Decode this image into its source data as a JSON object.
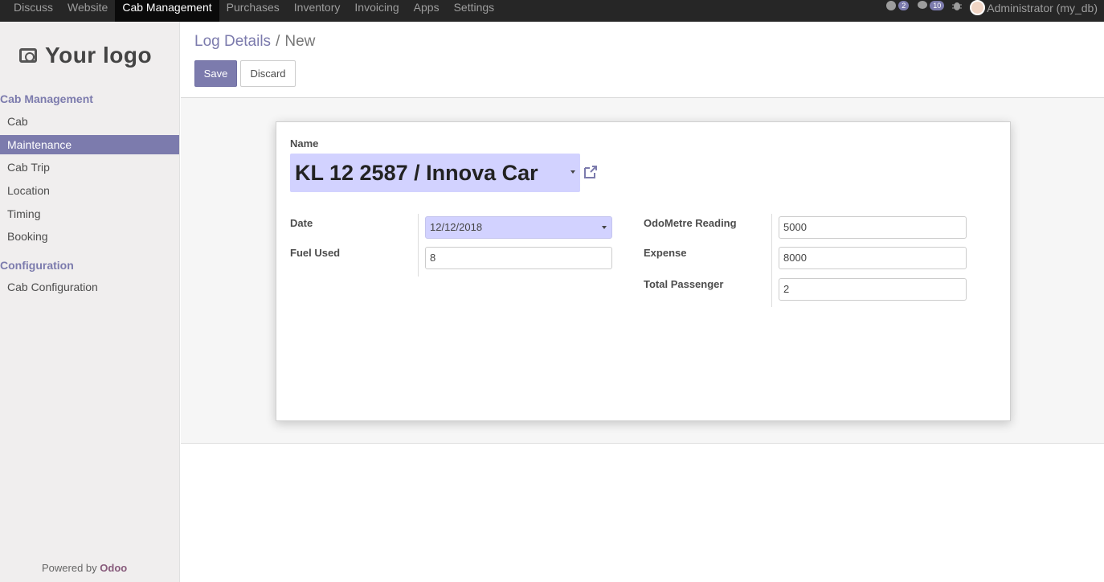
{
  "topnav": {
    "items": [
      "Discuss",
      "Website",
      "Cab Management",
      "Purchases",
      "Inventory",
      "Invoicing",
      "Apps",
      "Settings"
    ],
    "active": "Cab Management",
    "chat_badge": "2",
    "messages_badge": "10",
    "user": "Administrator (my_db)"
  },
  "sidebar": {
    "logo_text": "Your logo",
    "sections": [
      {
        "title": "Cab Management",
        "items": [
          "Cab",
          "Maintenance",
          "Cab Trip",
          "Location",
          "Timing",
          "Booking"
        ]
      },
      {
        "title": "Configuration",
        "items": [
          "Cab Configuration"
        ]
      }
    ],
    "active_item": "Maintenance",
    "powered_prefix": "Powered by",
    "powered_brand": "Odoo"
  },
  "control": {
    "breadcrumb_parent": "Log Details",
    "breadcrumb_sep": "/",
    "breadcrumb_current": "New",
    "save_label": "Save",
    "discard_label": "Discard"
  },
  "form": {
    "name_label": "Name",
    "name_value": "KL 12 2587 / Innova Car",
    "date_label": "Date",
    "date_value": "12/12/2018",
    "fuel_label": "Fuel Used",
    "fuel_value": "8",
    "odometer_label": "OdoMetre Reading",
    "odometer_value": "5000",
    "expense_label": "Expense",
    "expense_value": "8000",
    "passenger_label": "Total Passenger",
    "passenger_value": "2"
  },
  "colors": {
    "accent": "#7c7bad",
    "topbar": "#262626",
    "highlight_field": "#d2d2ff",
    "odoo_brand": "#875a7b"
  }
}
